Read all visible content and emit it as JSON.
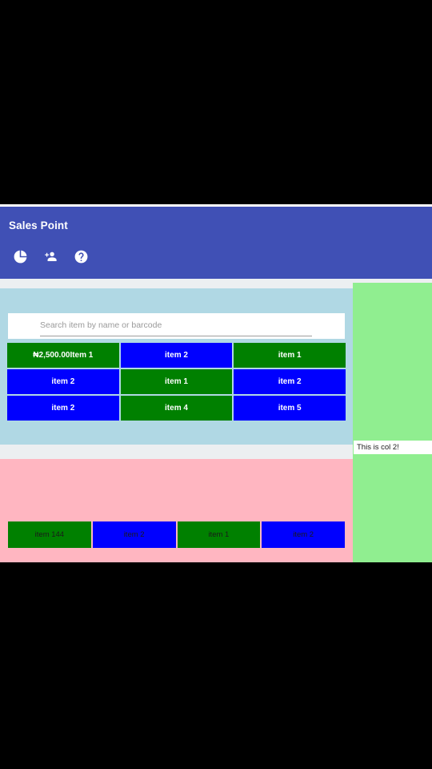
{
  "app": {
    "title": "Sales Point",
    "header_color": "#4050b5",
    "actions": [
      {
        "name": "pie-chart-icon",
        "label": "Reports"
      },
      {
        "name": "person-add-icon",
        "label": "Add Customer"
      },
      {
        "name": "help-icon",
        "label": "Help"
      }
    ]
  },
  "search": {
    "placeholder": "Search item by name or barcode",
    "value": ""
  },
  "item_grid": {
    "panel_color": "#b0d8e4",
    "tiles": [
      {
        "label": "₦2,500.00Item 1",
        "color": "green"
      },
      {
        "label": "item 2",
        "color": "blue"
      },
      {
        "label": "item 1",
        "color": "green"
      },
      {
        "label": "item 2",
        "color": "blue"
      },
      {
        "label": "item 1",
        "color": "green"
      },
      {
        "label": "item 2",
        "color": "blue"
      },
      {
        "label": "item 2",
        "color": "blue"
      },
      {
        "label": "item 4",
        "color": "green"
      },
      {
        "label": "item 5",
        "color": "blue"
      }
    ]
  },
  "cart": {
    "panel_color": "#ffb6c1",
    "tiles": [
      {
        "label": "item 144",
        "color": "green"
      },
      {
        "label": "item 2",
        "color": "blue"
      },
      {
        "label": "item 1",
        "color": "green"
      },
      {
        "label": "item 2",
        "color": "blue"
      }
    ]
  },
  "col2": {
    "panel_color": "#90ee90",
    "label": "This is col 2!"
  },
  "colors": {
    "tile_green": "#008000",
    "tile_blue": "#0000ff",
    "page_bg": "#eceff1"
  }
}
